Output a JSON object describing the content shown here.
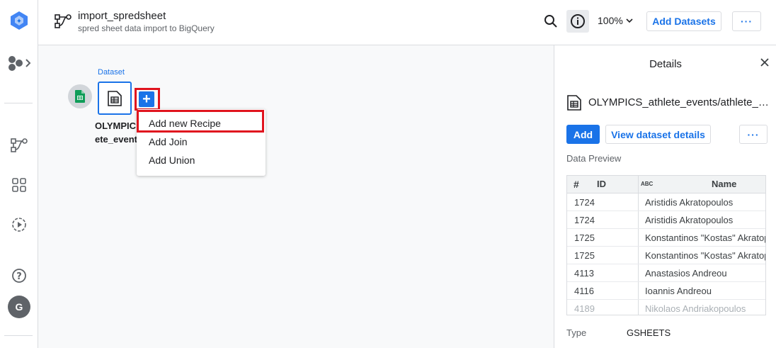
{
  "header": {
    "title": "import_spredsheet",
    "subtitle": "spred sheet data import to BigQuery",
    "zoom": "100%",
    "add_datasets_label": "Add Datasets",
    "more_label": "···"
  },
  "rail": {
    "avatar_letter": "G"
  },
  "canvas": {
    "dataset_label": "Dataset",
    "dataset_name_line1": "OLYMPIC",
    "dataset_name_line2": "ete_event",
    "plus_label": "+",
    "menu": {
      "items": [
        "Add new Recipe",
        "Add Join",
        "Add Union"
      ]
    }
  },
  "details": {
    "title": "Details",
    "file_name": "OLYMPICS_athlete_events/athlete_events",
    "add_label": "Add",
    "view_label": "View dataset details",
    "more_label": "···",
    "data_preview_label": "Data Preview",
    "columns": [
      {
        "type_icon": "#",
        "name": "ID"
      },
      {
        "type_icon": "ABC",
        "name": "Name"
      }
    ],
    "rows": [
      [
        "1724",
        "Aristidis Akratopoulos"
      ],
      [
        "1724",
        "Aristidis Akratopoulos"
      ],
      [
        "1725",
        "Konstantinos \"Kostas\" Akratopoulos"
      ],
      [
        "1725",
        "Konstantinos \"Kostas\" Akratopoulos"
      ],
      [
        "4113",
        "Anastasios Andreou"
      ],
      [
        "4116",
        "Ioannis Andreou"
      ],
      [
        "4189",
        "Nikolaos Andriakopoulos"
      ]
    ],
    "type_label": "Type",
    "type_value": "GSHEETS"
  },
  "colors": {
    "accent": "#1a73e8",
    "highlight": "#e0141e"
  }
}
